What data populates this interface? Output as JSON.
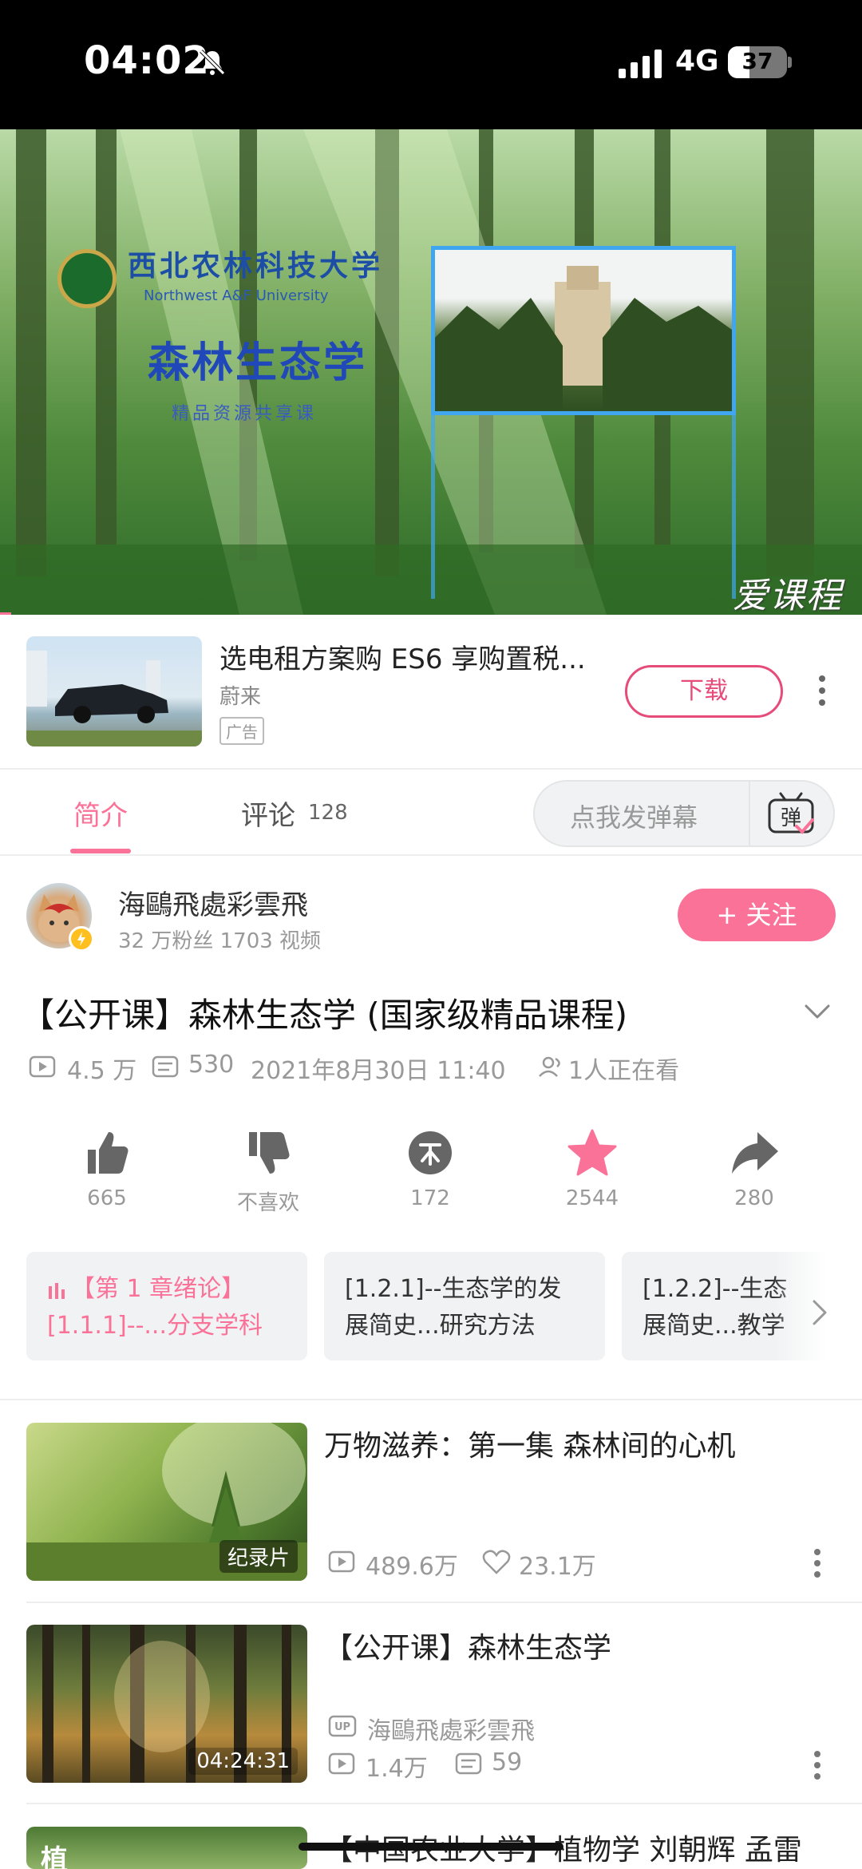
{
  "status_bar": {
    "time": "04:02",
    "network": "4G",
    "battery": "37",
    "battery_level": 0.37
  },
  "video": {
    "university_cn": "西北农林科技大学",
    "university_en": "Northwest A&F University",
    "course_title": "森林生态学",
    "course_subtitle": "精品资源共享课",
    "watermark": "爱课程"
  },
  "ad": {
    "title": "选电租方案购 ES6 享购置税...",
    "brand": "蔚来",
    "tag": "广告",
    "download_label": "下载"
  },
  "tabs": [
    {
      "label": "简介"
    },
    {
      "label": "评论",
      "count": "128"
    }
  ],
  "danmaku": {
    "placeholder": "点我发弹幕",
    "button_label": "弹"
  },
  "uploader": {
    "name": "海鷗飛處彩雲飛",
    "stats": "32 万粉丝  1703 视频",
    "follow_label": "+ 关注"
  },
  "video_info": {
    "title": "【公开课】森林生态学 (国家级精品课程)",
    "views": "4.5 万",
    "danmaku_count": "530",
    "date": "2021年8月30日 11:40",
    "watching": "1人正在看"
  },
  "actions": [
    {
      "name": "like",
      "label": "665"
    },
    {
      "name": "dislike",
      "label": "不喜欢"
    },
    {
      "name": "coin",
      "label": "172"
    },
    {
      "name": "favorite",
      "label": "2544"
    },
    {
      "name": "share",
      "label": "280"
    }
  ],
  "episodes": [
    {
      "line1": "【第 1 章绪论】",
      "line2": "[1.1.1]--...分支学科",
      "active": true
    },
    {
      "line1": "[1.2.1]--生态学的发",
      "line2": "展简史...研究方法",
      "active": false
    },
    {
      "line1": "[1.2.2]--生态",
      "line2": "展简史...教学",
      "active": false
    }
  ],
  "recommendations": [
    {
      "title": "万物滋养：第一集  森林间的心机",
      "badge": "纪录片",
      "views": "489.6万",
      "likes": "23.1万"
    },
    {
      "title": "【公开课】森林生态学",
      "badge": "04:24:31",
      "uploader": "海鷗飛處彩雲飛",
      "views": "1.4万",
      "danmaku": "59"
    },
    {
      "title": "【中国农业大学】植物学  刘朝辉  孟雷",
      "badge": "植"
    }
  ],
  "colors": {
    "accent": "#fb7299",
    "ad_button": "#e64b7a",
    "coin_badge": "#ffbf1f"
  }
}
